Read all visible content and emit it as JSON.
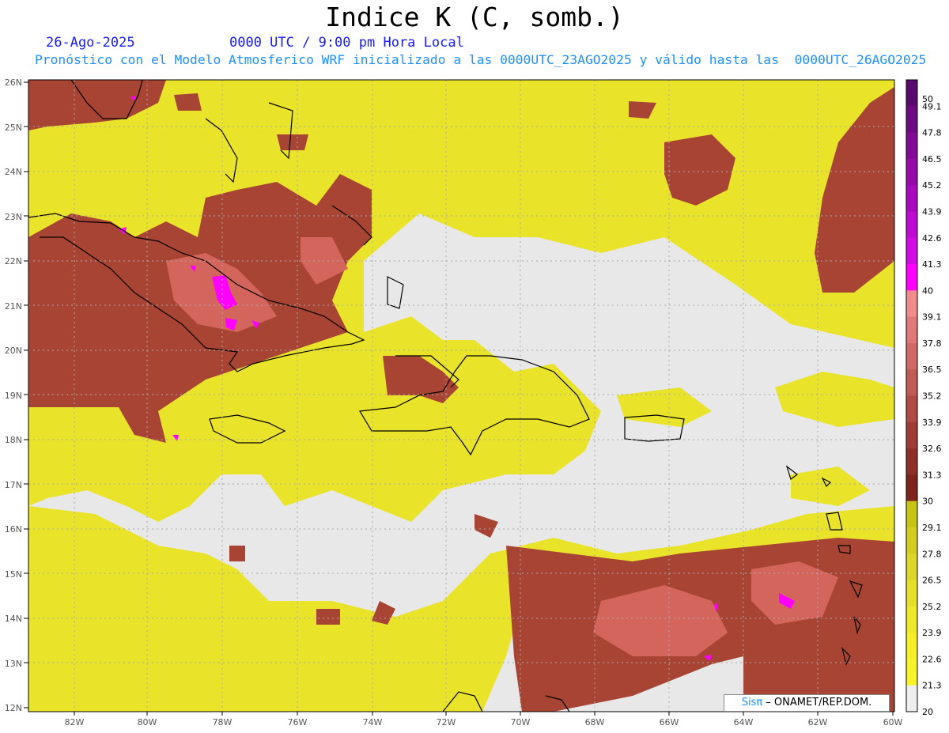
{
  "header": {
    "title": "Indice K (C, somb.)",
    "date": "26-Ago-2025",
    "time": "0000 UTC / 9:00 pm Hora Local",
    "description": "Pronóstico con el Modelo Atmosferico WRF inicializado a las 0000UTC_23AGO2025 y válido hasta las  0000UTC_26AGO2025"
  },
  "map": {
    "lat_labels": [
      "26N",
      "25N",
      "24N",
      "23N",
      "22N",
      "21N",
      "20N",
      "19N",
      "18N",
      "17N",
      "16N",
      "15N",
      "14N",
      "13N",
      "12N"
    ],
    "lon_labels": [
      "82W",
      "80W",
      "78W",
      "76W",
      "74W",
      "72W",
      "70W",
      "68W",
      "66W",
      "64W",
      "62W",
      "60W"
    ],
    "lat_range": [
      12,
      26
    ],
    "lon_range": [
      -83.2,
      -60
    ],
    "grid": true
  },
  "colorbar": {
    "labels": [
      "50",
      "49.1",
      "47.8",
      "46.5",
      "45.2",
      "43.9",
      "42.6",
      "41.3",
      "40",
      "39.1",
      "37.8",
      "36.5",
      "35.2",
      "33.9",
      "32.6",
      "31.3",
      "30",
      "29.1",
      "27.8",
      "26.5",
      "25.2",
      "23.9",
      "22.6",
      "21.3",
      "20"
    ],
    "colors": [
      "#5a0a6e",
      "#6e0a82",
      "#820a96",
      "#960aaa",
      "#aa0abe",
      "#be0ad2",
      "#d20ae6",
      "#ff00ff",
      "#f08c8c",
      "#e07a78",
      "#d06a66",
      "#c05a55",
      "#b04a45",
      "#a03c36",
      "#8f2f28",
      "#7f241c",
      "#c8c414",
      "#d2cd1e",
      "#dcd628",
      "#e6df2a",
      "#efe82a",
      "#f5ee28",
      "#f8f228",
      "#eeeeee"
    ]
  },
  "credit": {
    "sis": "Sisπ",
    "text": " – ONAMET/REP.DOM."
  }
}
